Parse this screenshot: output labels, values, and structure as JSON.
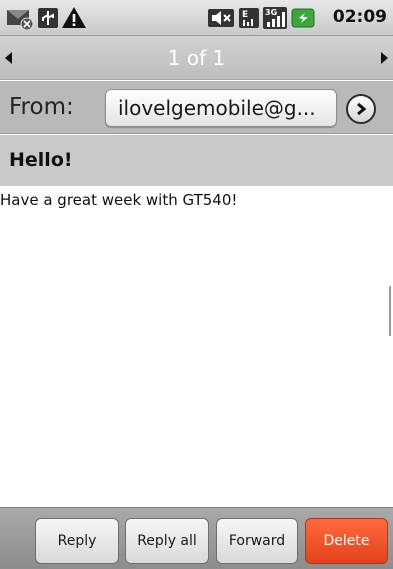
{
  "status_bar": {
    "time": "02:09",
    "icons": [
      "missed-message-icon",
      "usb-icon",
      "warning-icon",
      "mute-icon",
      "network-e-icon",
      "signal-3g-icon",
      "battery-icon"
    ],
    "colors": {
      "battery": "#3aa83a"
    }
  },
  "pager": {
    "label": "1 of 1"
  },
  "from": {
    "label": "From:",
    "address": "ilovelgemobile@g..."
  },
  "subject": "Hello!",
  "body": "Have a great week with GT540!",
  "buttons": {
    "reply": "Reply",
    "reply_all": "Reply all",
    "forward": "Forward",
    "delete": "Delete",
    "delete_color": "#ff5a2b"
  }
}
